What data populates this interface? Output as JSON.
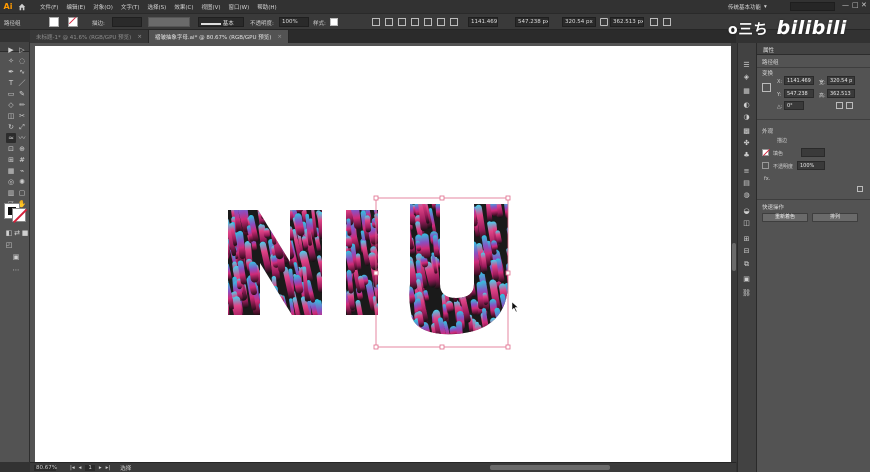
{
  "app": {
    "logo": "Ai"
  },
  "menu": {
    "items": [
      "文件(F)",
      "编辑(E)",
      "对象(O)",
      "文字(T)",
      "选择(S)",
      "效果(C)",
      "视图(V)",
      "窗口(W)",
      "帮助(H)"
    ],
    "workspace": "传统基本功能",
    "window_controls": [
      "—",
      "□",
      "✕"
    ]
  },
  "control_bar": {
    "stroke_label": "描边:",
    "stroke_style": "基本",
    "opacity_label": "不透明度:",
    "opacity_value": "100%",
    "style_label": "样式:",
    "x_value": "1141.469",
    "y_value": "547.238 px",
    "w_value": "320.54 px",
    "h_value": "362.513 px"
  },
  "tabs": [
    {
      "label": "未标题-1* @ 41.6% (RGB/GPU 预览)",
      "active": false,
      "close": "×"
    },
    {
      "label": "褶皱抽象字母.ai* @ 80.67% (RGB/GPU 预览)",
      "active": true,
      "close": "×"
    }
  ],
  "toolpanel": {
    "header": ""
  },
  "status_bar": {
    "zoom": "80.67%",
    "artboard_number": "1",
    "tool_name": "选择"
  },
  "properties": {
    "tab": "属性",
    "section_doc": "路径组",
    "section_transform": "变换",
    "x_label": "X:",
    "x_value": "1141.469",
    "y_label": "Y:",
    "y_value": "547.238",
    "w_label": "宽:",
    "w_value": "320.54 p",
    "h_label": "高:",
    "h_value": "362.513",
    "angle_label": "△:",
    "angle_value": "0°",
    "section_appearance": "外观",
    "fill_label": "填色",
    "stroke_label": "描边",
    "opacity_label": "不透明度",
    "opacity_value": "100%",
    "fx_label": "fx.",
    "section_quick": "快速操作",
    "btn_recolor": "重新着色",
    "btn_arrange": "排列"
  },
  "watermark": {
    "tv": "o三ち",
    "logo": "bilibili"
  },
  "colors": {
    "cyan": "#2fc6e0",
    "magenta": "#b0206a",
    "pink": "#e0407f",
    "dark": "#1a1a1a",
    "selection": "#e06a8a"
  }
}
